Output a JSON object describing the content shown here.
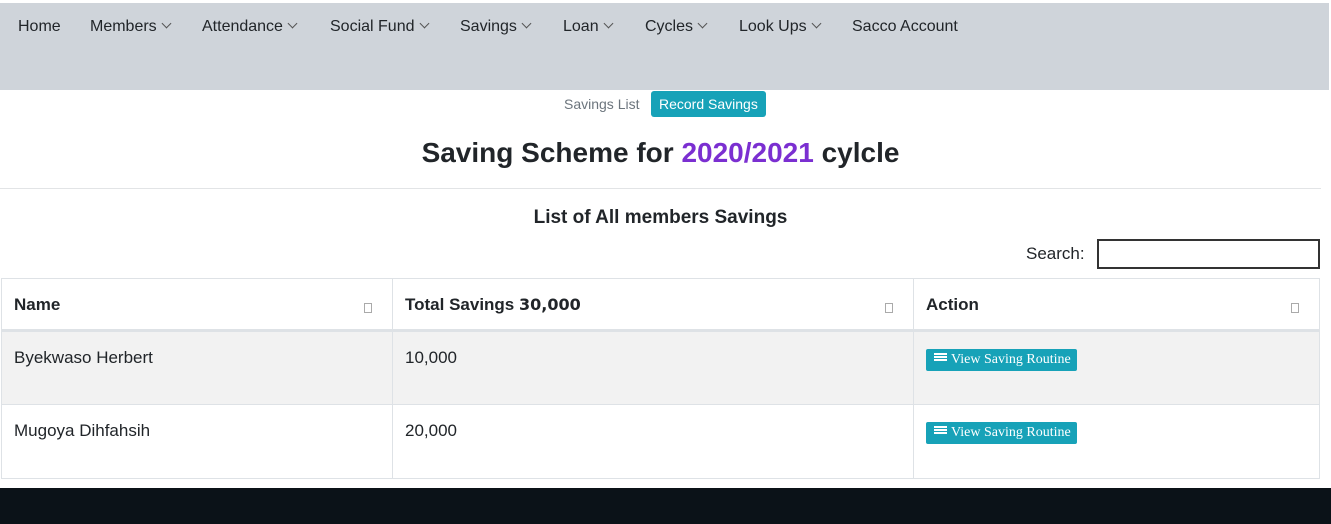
{
  "nav": {
    "items": [
      {
        "label": "Home",
        "dropdown": false
      },
      {
        "label": "Members",
        "dropdown": true
      },
      {
        "label": "Attendance",
        "dropdown": true
      },
      {
        "label": "Social Fund",
        "dropdown": true
      },
      {
        "label": "Savings",
        "dropdown": true
      },
      {
        "label": "Loan",
        "dropdown": true
      },
      {
        "label": "Cycles",
        "dropdown": true
      },
      {
        "label": "Look Ups",
        "dropdown": true
      },
      {
        "label": "Sacco Account",
        "dropdown": false
      }
    ]
  },
  "subnav": {
    "savings_list": "Savings List",
    "record_savings": "Record Savings"
  },
  "page": {
    "title_prefix": "Saving Scheme for",
    "title_year": "2020/2021",
    "title_suffix": "cylcle",
    "subtitle": "List of All members Savings"
  },
  "search": {
    "label": "Search:",
    "value": ""
  },
  "table": {
    "headers": {
      "name": "Name",
      "total_label": "Total Savings",
      "total_value": "30,000",
      "action": "Action"
    },
    "rows": [
      {
        "name": "Byekwaso Herbert",
        "amount": "10,000",
        "action": "View Saving Routine"
      },
      {
        "name": "Mugoya Dihfahsih",
        "amount": "20,000",
        "action": "View Saving Routine"
      }
    ]
  },
  "colors": {
    "accent": "#17a2b8",
    "year_highlight": "#7b2fd1",
    "navbar_bg": "#cfd4da"
  }
}
